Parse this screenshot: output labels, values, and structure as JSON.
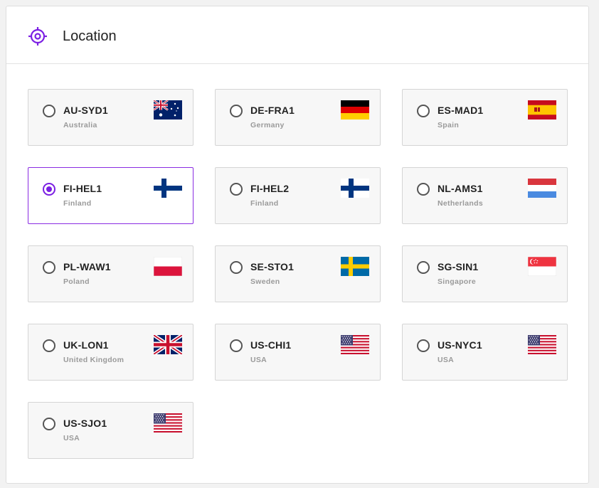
{
  "header": {
    "title": "Location",
    "icon": "crosshair-icon",
    "accent_color": "#7b1fe3"
  },
  "locations": [
    {
      "code": "AU-SYD1",
      "country": "Australia",
      "flag": "flag-australia-icon",
      "selected": false
    },
    {
      "code": "DE-FRA1",
      "country": "Germany",
      "flag": "flag-germany-icon",
      "selected": false
    },
    {
      "code": "ES-MAD1",
      "country": "Spain",
      "flag": "flag-spain-icon",
      "selected": false
    },
    {
      "code": "FI-HEL1",
      "country": "Finland",
      "flag": "flag-finland-icon",
      "selected": true
    },
    {
      "code": "FI-HEL2",
      "country": "Finland",
      "flag": "flag-finland-icon",
      "selected": false
    },
    {
      "code": "NL-AMS1",
      "country": "Netherlands",
      "flag": "flag-netherlands-icon",
      "selected": false
    },
    {
      "code": "PL-WAW1",
      "country": "Poland",
      "flag": "flag-poland-icon",
      "selected": false
    },
    {
      "code": "SE-STO1",
      "country": "Sweden",
      "flag": "flag-sweden-icon",
      "selected": false
    },
    {
      "code": "SG-SIN1",
      "country": "Singapore",
      "flag": "flag-singapore-icon",
      "selected": false
    },
    {
      "code": "UK-LON1",
      "country": "United Kingdom",
      "flag": "flag-uk-icon",
      "selected": false
    },
    {
      "code": "US-CHI1",
      "country": "USA",
      "flag": "flag-usa-icon",
      "selected": false
    },
    {
      "code": "US-NYC1",
      "country": "USA",
      "flag": "flag-usa-icon",
      "selected": false
    },
    {
      "code": "US-SJO1",
      "country": "USA",
      "flag": "flag-usa-icon",
      "selected": false
    }
  ]
}
